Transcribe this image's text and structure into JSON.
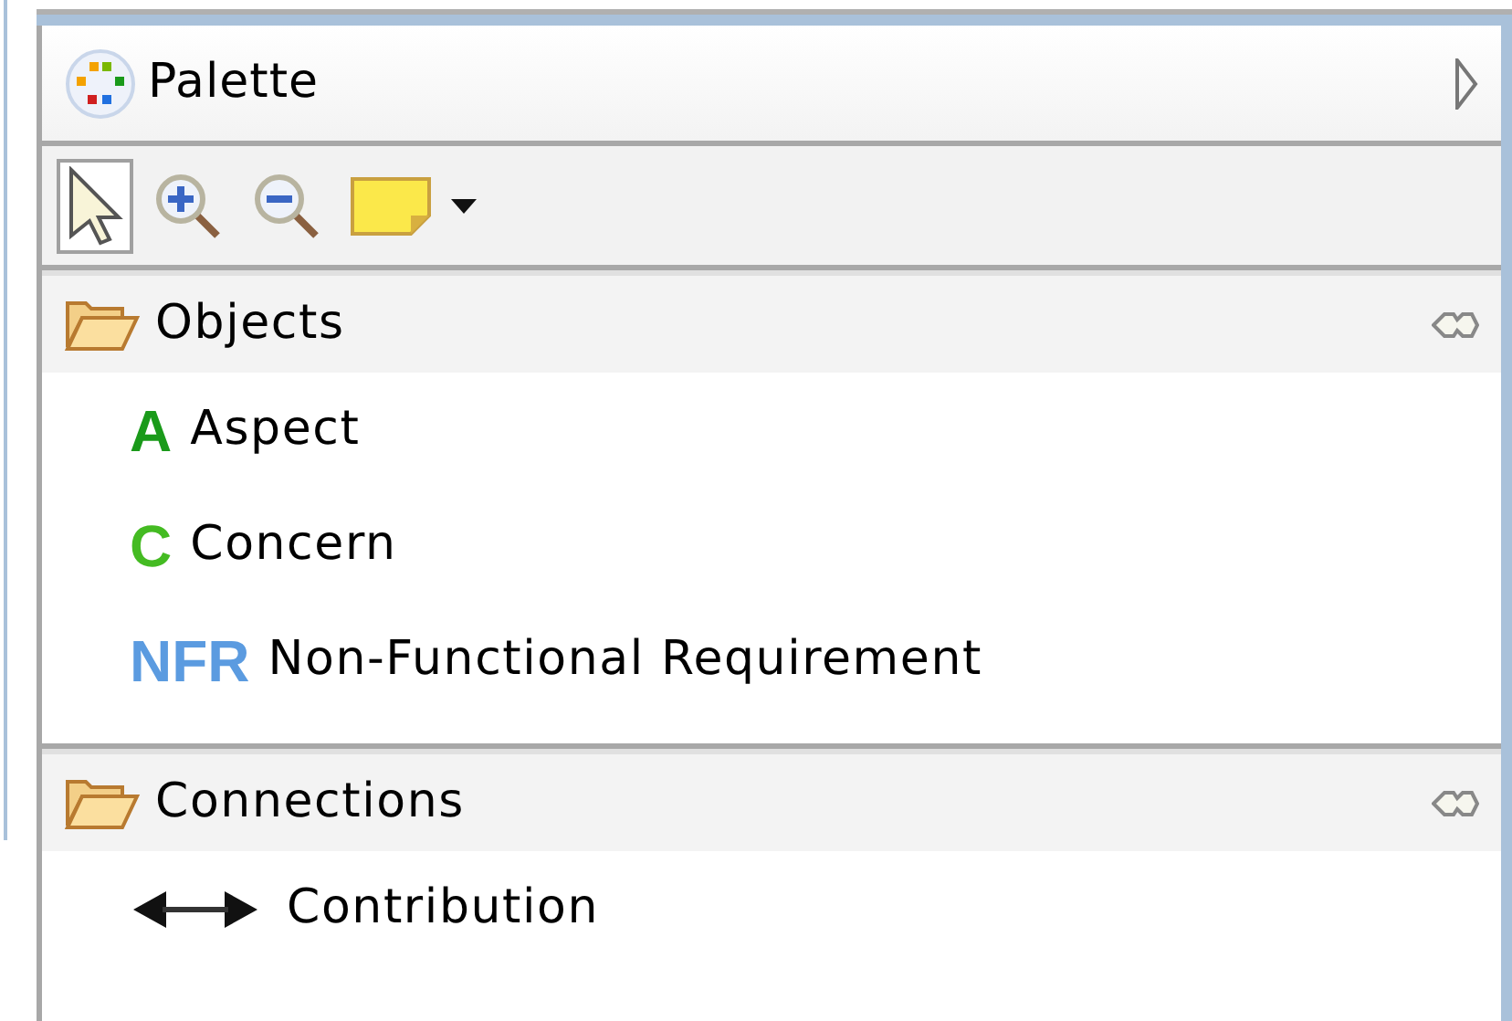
{
  "palette": {
    "title": "Palette",
    "collapsed": false
  },
  "tools": [
    {
      "kind": "select",
      "selected": true
    },
    {
      "kind": "zoom-in",
      "selected": false
    },
    {
      "kind": "zoom-out",
      "selected": false
    },
    {
      "kind": "note",
      "selected": false,
      "dropdown": true
    }
  ],
  "drawers": [
    {
      "label": "Objects",
      "expanded": true,
      "items": [
        {
          "kind": "letter",
          "icon_text": "A",
          "color": "#1a9a1a",
          "label": "Aspect"
        },
        {
          "kind": "letter",
          "icon_text": "C",
          "color": "#44bb22",
          "label": "Concern"
        },
        {
          "kind": "letter",
          "icon_text": "NFR",
          "color": "#5b9be0",
          "label": "Non-Functional Requirement"
        }
      ]
    },
    {
      "label": "Connections",
      "expanded": true,
      "items": [
        {
          "kind": "arrow",
          "label": "Contribution"
        }
      ]
    }
  ]
}
